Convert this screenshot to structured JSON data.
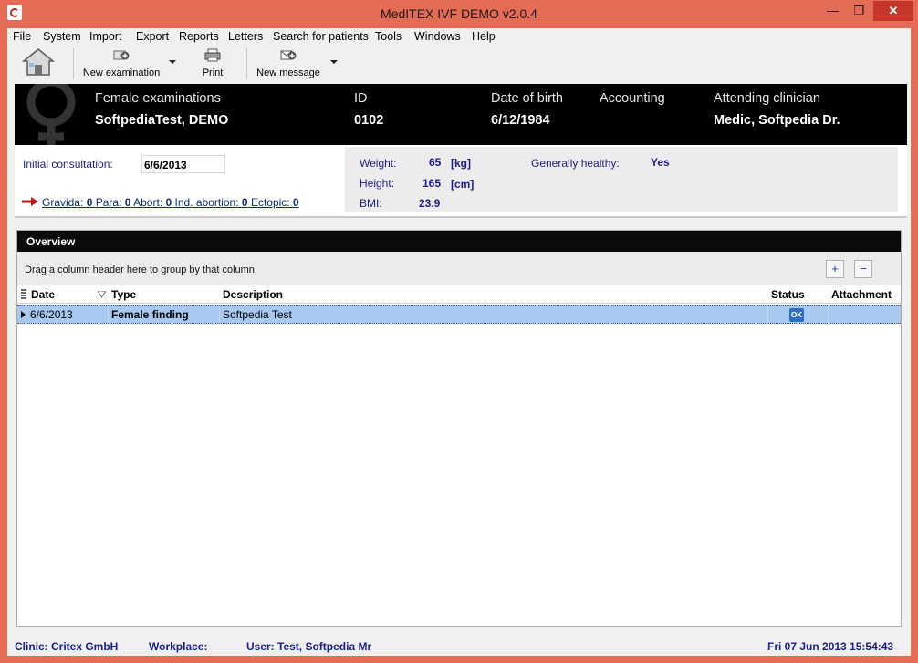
{
  "window": {
    "title": "MedITEX IVF DEMO v2.0.4",
    "min": "—",
    "max": "❐",
    "close": "✕"
  },
  "menu": [
    "File",
    "System",
    "Import",
    "Export",
    "Reports",
    "Letters",
    "Search for patients",
    "Tools",
    "Windows",
    "Help"
  ],
  "toolbar": {
    "home_icon": "home-icon",
    "new_examination": "New examination",
    "print": "Print",
    "new_message": "New message"
  },
  "patient": {
    "section_label": "Female examinations",
    "name": "SoftpediaTest, DEMO",
    "id_label": "ID",
    "id": "0102",
    "dob_label": "Date of birth",
    "dob": "6/12/1984",
    "accounting_label": "Accounting",
    "accounting": "",
    "clinician_label": "Attending clinician",
    "clinician": "Medic, Softpedia Dr."
  },
  "info": {
    "initial_consultation_label": "Initial consultation:",
    "initial_consultation": "6/6/2013",
    "history": {
      "gravida_label": "Gravida:",
      "gravida": "0",
      "para_label": "Para:",
      "para": "0",
      "abort_label": "Abort:",
      "abort": "0",
      "ind_abortion_label": "Ind. abortion:",
      "ind_abortion": "0",
      "ectopic_label": "Ectopic:",
      "ectopic": "0"
    },
    "weight_label": "Weight:",
    "weight": "65",
    "weight_unit": "[kg]",
    "height_label": "Height:",
    "height": "165",
    "height_unit": "[cm]",
    "bmi_label": "BMI:",
    "bmi": "23.9",
    "healthy_label": "Generally healthy:",
    "healthy": "Yes"
  },
  "overview": {
    "title": "Overview",
    "group_hint": "Drag a column header here to group by that column",
    "expand": "+",
    "collapse": "−",
    "columns": [
      "Date",
      "Type",
      "Description",
      "Status",
      "Attachment"
    ],
    "rows": [
      {
        "date": "6/6/2013",
        "type": "Female finding",
        "description": "Softpedia Test",
        "status": "OK",
        "attachment": ""
      }
    ]
  },
  "status": {
    "clinic": "Clinic: Critex GmbH",
    "workplace": "Workplace:",
    "user": "User: Test, Softpedia Mr",
    "datetime": "Fri 07 Jun 2013 15:54:43"
  },
  "colors": {
    "titlebar": "#e46c55",
    "header_bg": "#000000",
    "row_selected": "#a7c9ef",
    "label_blue": "#1c1c8c"
  }
}
